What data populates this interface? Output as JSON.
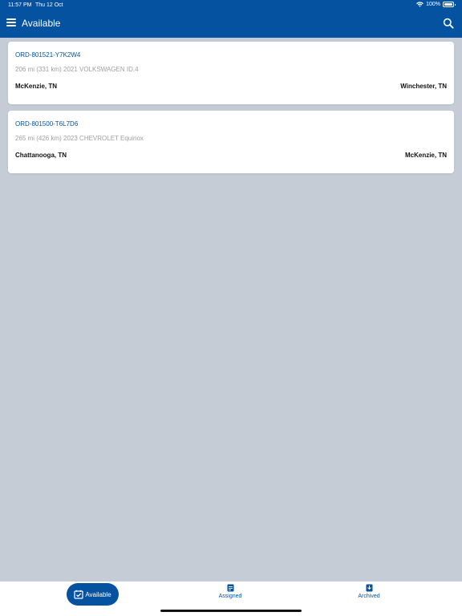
{
  "status": {
    "time": "11:57 PM",
    "date": "Thu 12 Oct",
    "battery": "100%",
    "battery_level": 1.0
  },
  "header": {
    "title": "Available",
    "color": "#0452a0"
  },
  "orders": [
    {
      "id": "ORD-801521-Y7K2W4",
      "description": "206 mi (331 km) 2021 VOLKSWAGEN ID.4",
      "from": "McKenzie, TN",
      "to": "Winchester, TN"
    },
    {
      "id": "ORD-801500-T6L7D6",
      "description": "265 mi (426 km) 2023 CHEVROLET Equinox",
      "from": "Chattanooga, TN",
      "to": "McKenzie, TN"
    }
  ],
  "tabs": {
    "available": "Available",
    "assigned": "Assigned",
    "archived": "Archived"
  },
  "icons": {
    "menu": "menu-icon",
    "search": "search-icon",
    "wifi": "wifi-icon",
    "battery": "battery-icon",
    "available": "calendar-check-icon",
    "assigned": "clipboard-icon",
    "archived": "archive-box-icon"
  }
}
